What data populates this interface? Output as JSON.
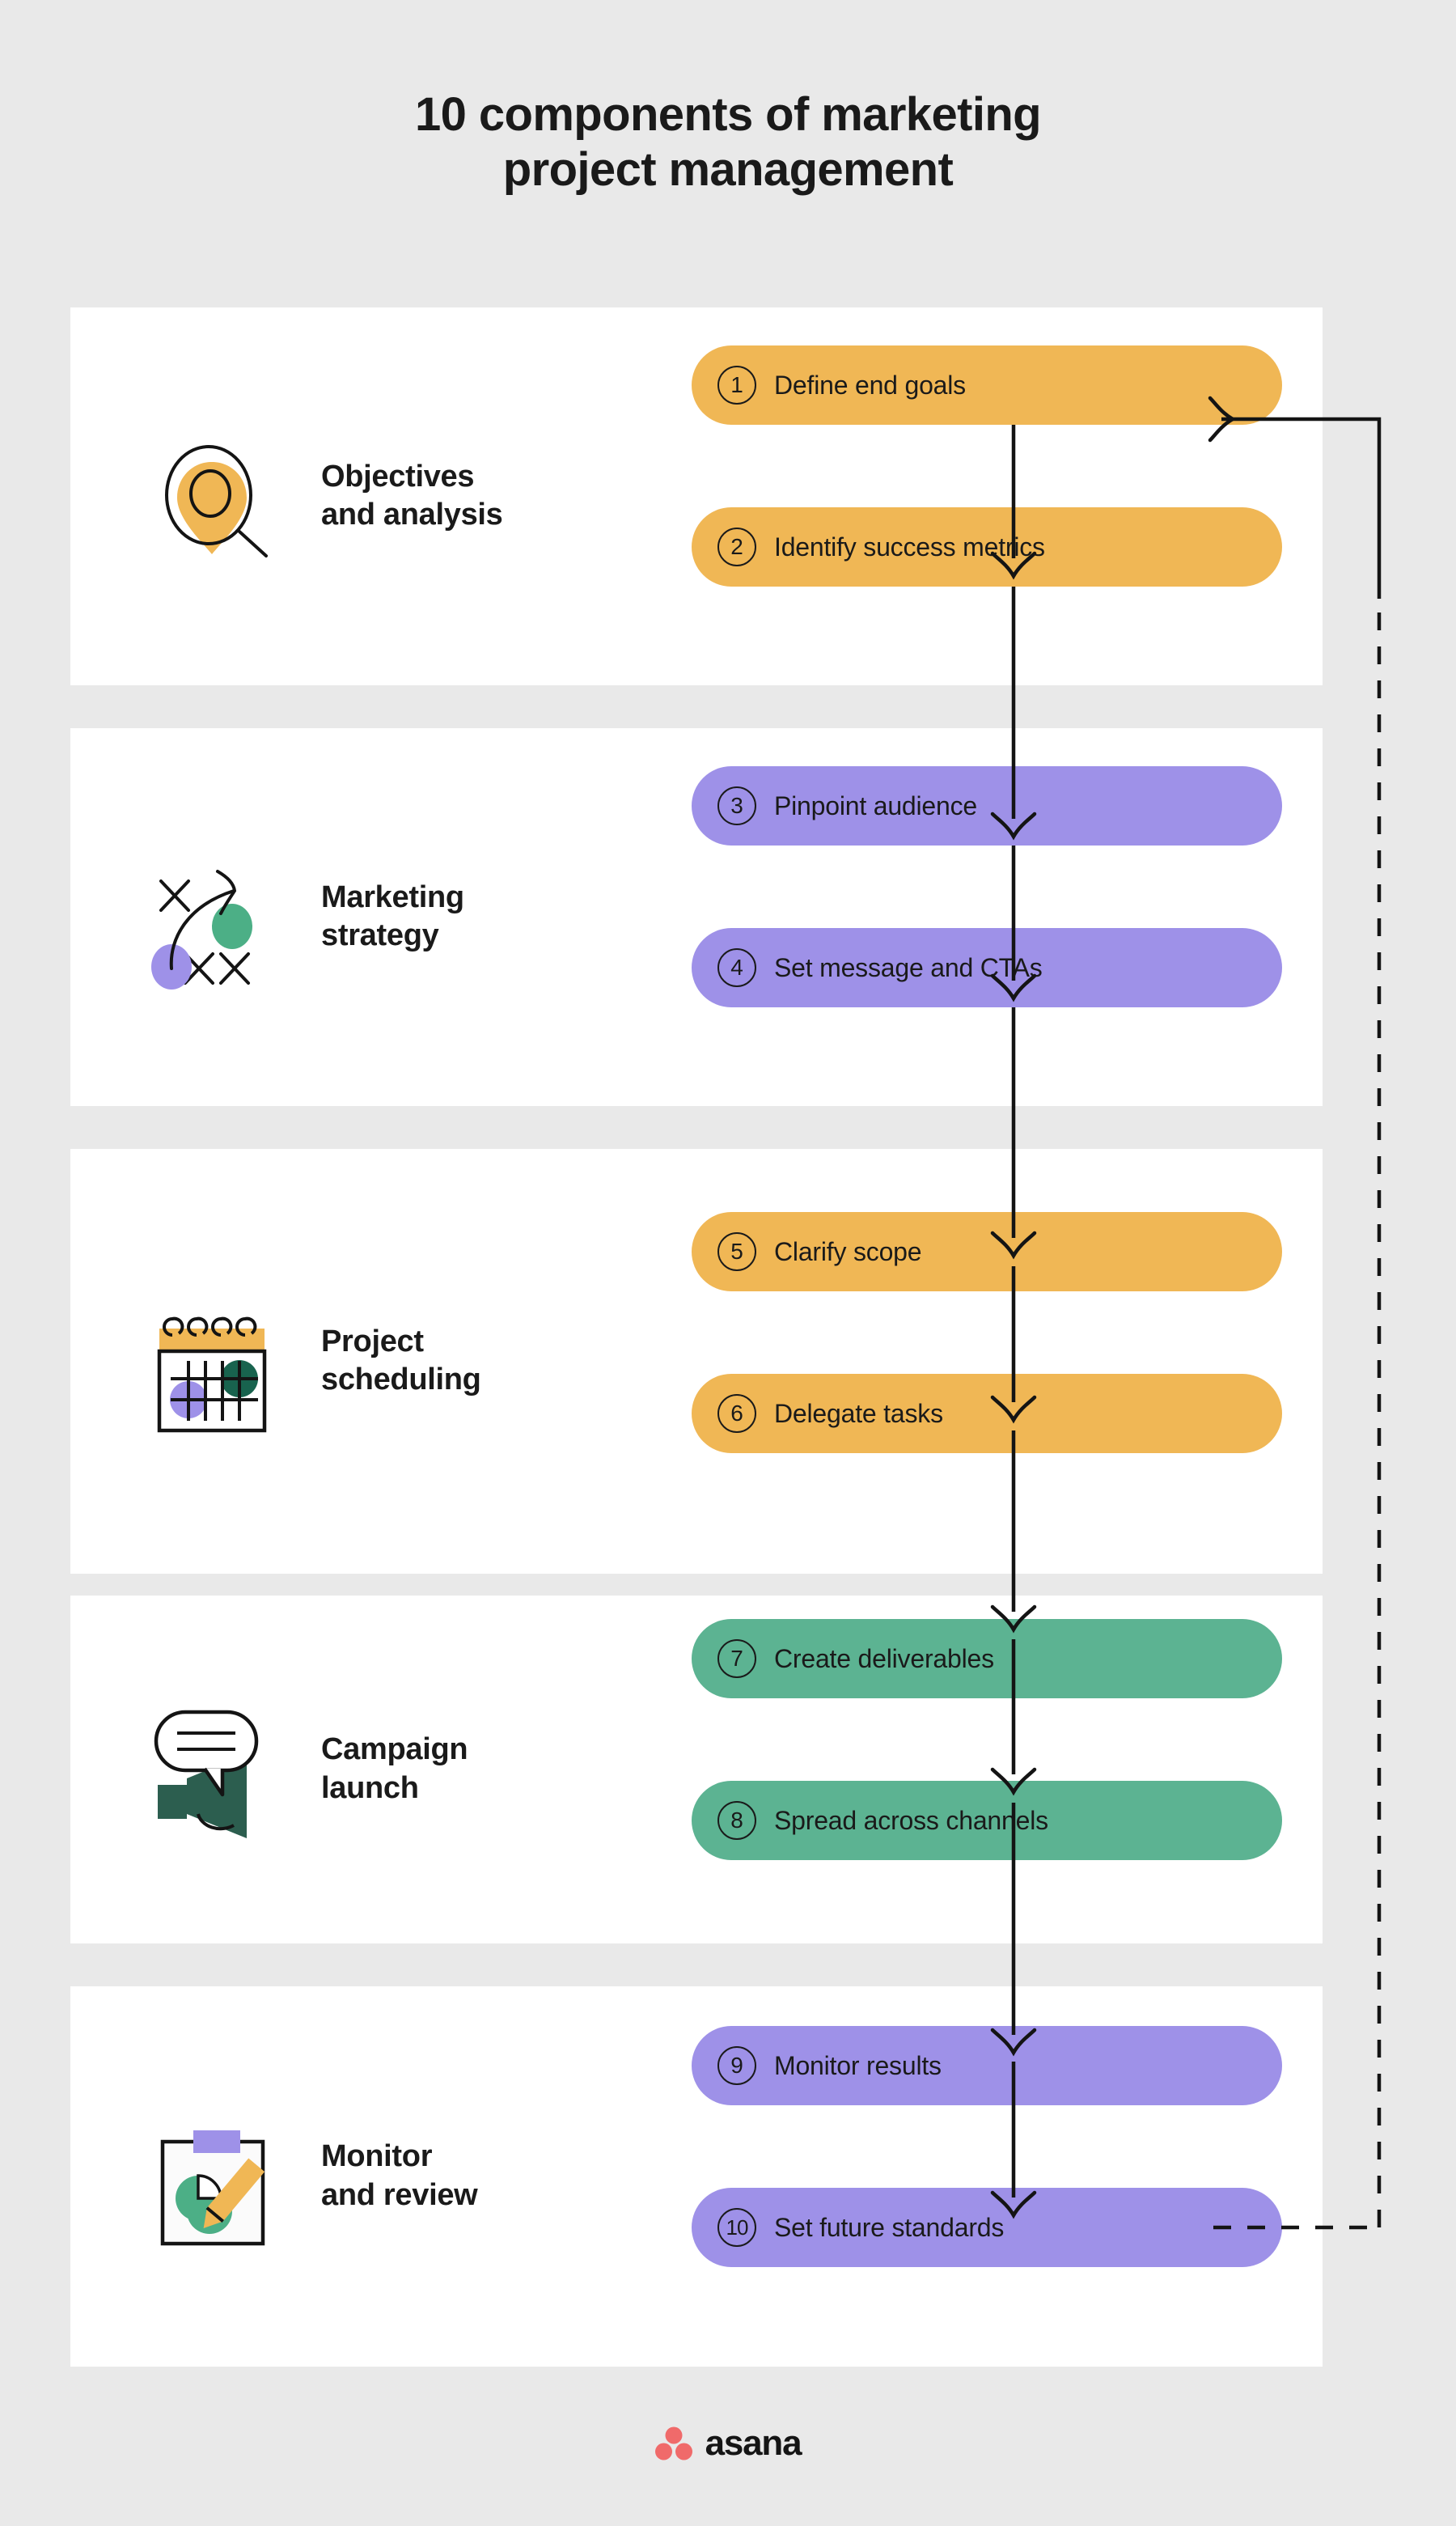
{
  "title": "10 components of marketing\nproject management",
  "colors": {
    "background": "#e9e9e9",
    "panel": "#ffffff",
    "amber": "#f0b755",
    "purple": "#9e91e8",
    "green": "#5cb392",
    "dark_green": "#2c5e4f",
    "ink": "#1a1a1a",
    "asana_coral": "#f06a6a"
  },
  "sections": [
    {
      "id": "objectives-and-analysis",
      "label": "Objectives\nand analysis",
      "icon": "magnifier-location-pin-icon",
      "color": "amber",
      "steps": [
        {
          "number": "1",
          "text": "Define end goals"
        },
        {
          "number": "2",
          "text": "Identify success metrics"
        }
      ]
    },
    {
      "id": "marketing-strategy",
      "label": "Marketing\nstrategy",
      "icon": "strategy-play-diagram-icon",
      "color": "purple",
      "steps": [
        {
          "number": "3",
          "text": "Pinpoint audience"
        },
        {
          "number": "4",
          "text": "Set message and CTAs"
        }
      ]
    },
    {
      "id": "project-scheduling",
      "label": "Project\nscheduling",
      "icon": "calendar-icon",
      "color": "amber",
      "steps": [
        {
          "number": "5",
          "text": "Clarify scope"
        },
        {
          "number": "6",
          "text": "Delegate tasks"
        }
      ]
    },
    {
      "id": "campaign-launch",
      "label": "Campaign\nlaunch",
      "icon": "megaphone-speech-bubble-icon",
      "color": "green",
      "steps": [
        {
          "number": "7",
          "text": "Create deliverables"
        },
        {
          "number": "8",
          "text": "Spread across channels"
        }
      ]
    },
    {
      "id": "monitor-and-review",
      "label": "Monitor\nand review",
      "icon": "clipboard-chart-pencil-icon",
      "color": "purple",
      "steps": [
        {
          "number": "9",
          "text": "Monitor results"
        },
        {
          "number": "10",
          "text": "Set future standards"
        }
      ]
    }
  ],
  "feedback_loop": {
    "from_step": "10",
    "to_step": "1",
    "style": "dashed"
  },
  "footer": {
    "brand": "asana",
    "logo_icon": "asana-logo-icon"
  }
}
